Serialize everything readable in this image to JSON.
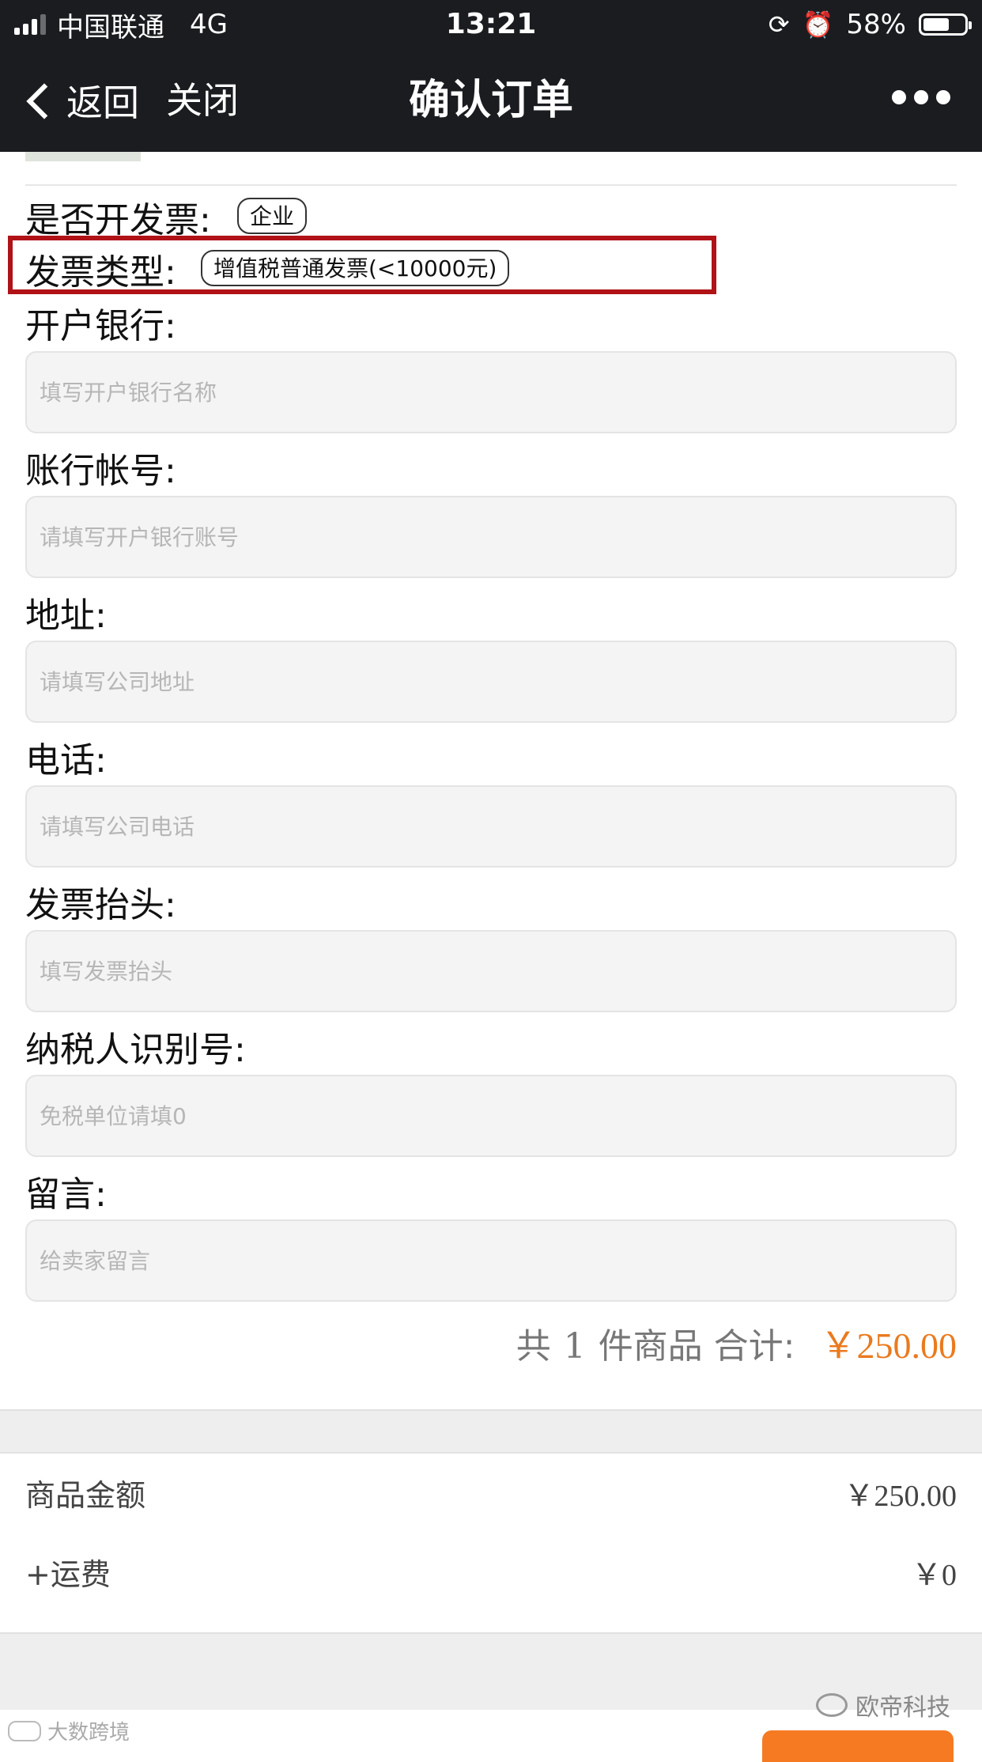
{
  "status_bar": {
    "carrier": "中国联通",
    "network": "4G",
    "time": "13:21",
    "battery_percent": "58%",
    "rotation_lock_icon": "rotation-lock-icon",
    "alarm_icon": "alarm-icon"
  },
  "nav": {
    "back_label": "返回",
    "close_label": "关闭",
    "title": "确认订单",
    "more_icon": "more-dots-icon"
  },
  "invoice": {
    "need_invoice_label": "是否开发票:",
    "need_invoice_value": "企业",
    "invoice_type_label": "发票类型:",
    "invoice_type_value": "增值税普通发票(<10000元)",
    "highlight_color": "#b01217"
  },
  "fields": [
    {
      "label": "开户银行:",
      "placeholder": "填写开户银行名称",
      "value": ""
    },
    {
      "label": "账行帐号:",
      "placeholder": "请填写开户银行账号",
      "value": ""
    },
    {
      "label": "地址:",
      "placeholder": "请填写公司地址",
      "value": ""
    },
    {
      "label": "电话:",
      "placeholder": "请填写公司电话",
      "value": ""
    },
    {
      "label": "发票抬头:",
      "placeholder": "填写发票抬头",
      "value": ""
    },
    {
      "label": "纳税人识别号:",
      "placeholder": "免税单位请填0",
      "value": ""
    },
    {
      "label": "留言:",
      "placeholder": "给卖家留言",
      "value": ""
    }
  ],
  "order_total": {
    "prefix": "共",
    "count": "1",
    "suffix": "件商品 合计:",
    "amount": "￥250.00",
    "accent_color": "#ea7a1e"
  },
  "summary": {
    "goods_amount_label": "商品金额",
    "goods_amount_value": "￥250.00",
    "shipping_label": "+运费",
    "shipping_value": "￥0"
  },
  "watermarks": {
    "right_text": "欧帝科技",
    "right_icon": "wechat-icon",
    "left_text": "大数跨境",
    "left_icon": "logo-icon"
  }
}
